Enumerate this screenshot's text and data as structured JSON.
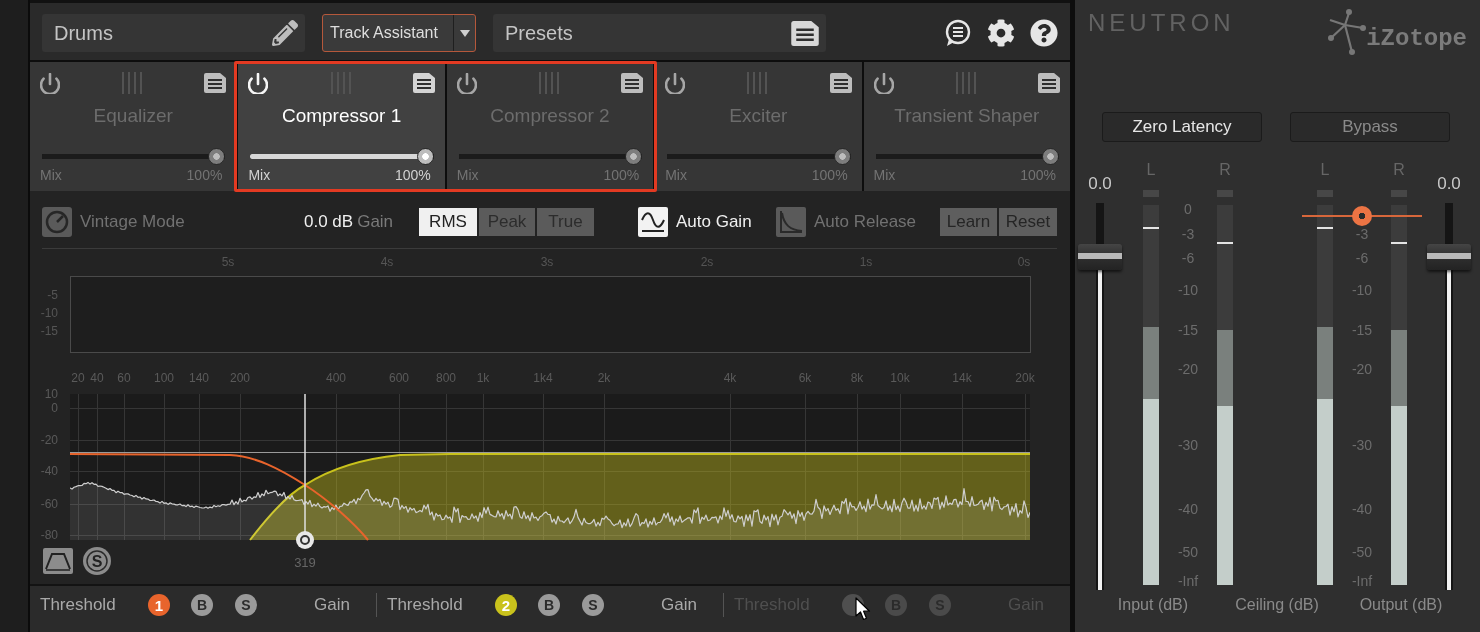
{
  "header": {
    "track_name": "Drums",
    "assistant_button": "Track Assistant",
    "presets": "Presets"
  },
  "modules": [
    {
      "name": "Equalizer",
      "selected": false,
      "highlighted": false,
      "mix_label": "Mix",
      "mix_value": "100%",
      "mix": {
        "level": 1
      }
    },
    {
      "name": "Compressor 1",
      "selected": true,
      "highlighted": true,
      "mix_label": "Mix",
      "mix_value": "100%",
      "mix": {
        "level": 1
      }
    },
    {
      "name": "Compressor 2",
      "selected": false,
      "highlighted": true,
      "mix_label": "Mix",
      "mix_value": "100%",
      "mix": {
        "level": 1
      }
    },
    {
      "name": "Exciter",
      "selected": false,
      "highlighted": false,
      "mix_label": "Mix",
      "mix_value": "100%",
      "mix": {
        "level": 1
      }
    },
    {
      "name": "Transient Shaper",
      "selected": false,
      "highlighted": false,
      "mix_label": "Mix",
      "mix_value": "100%",
      "mix": {
        "level": 1
      }
    }
  ],
  "controls": {
    "vintage_mode": {
      "label": "Vintage Mode",
      "on": false
    },
    "gain": {
      "value": "0.0 dB",
      "label": "Gain"
    },
    "detection_modes": [
      {
        "label": "RMS",
        "selected": true
      },
      {
        "label": "Peak",
        "selected": false
      },
      {
        "label": "True",
        "selected": false
      }
    ],
    "auto_gain": {
      "label": "Auto Gain",
      "on": true
    },
    "auto_release": {
      "label": "Auto Release",
      "on": false
    },
    "buttons": [
      "Learn",
      "Reset"
    ]
  },
  "gain_reduction": {
    "time_labels": [
      "5s",
      "4s",
      "3s",
      "2s",
      "1s",
      "0s"
    ],
    "db_labels": [
      "-5",
      "-10",
      "-15"
    ]
  },
  "spectrum": {
    "freq_labels": [
      "20",
      "40",
      "60",
      "100",
      "140",
      "200",
      "400",
      "600",
      "800",
      "1k",
      "1k4",
      "2k",
      "4k",
      "6k",
      "8k",
      "10k",
      "14k",
      "20k"
    ],
    "db_labels": [
      "10",
      "0",
      "-20",
      "-40",
      "-60",
      "-80"
    ],
    "crossover": "319",
    "solo_button": "S"
  },
  "bands": [
    {
      "threshold_label": "Threshold",
      "number": "1",
      "color": "#e8642c",
      "enabled": true,
      "bypass": "B",
      "solo": "S",
      "gain_label": "Gain"
    },
    {
      "threshold_label": "Threshold",
      "number": "2",
      "color": "#c9c21c",
      "enabled": true,
      "bypass": "B",
      "solo": "S",
      "gain_label": "Gain"
    },
    {
      "threshold_label": "Threshold",
      "color": "#4f4f4f",
      "enabled": false,
      "bypass": "B",
      "solo": "S",
      "gain_label": "Gain"
    }
  ],
  "output_panel": {
    "brand": "NEUTRON",
    "logo": "iZotope",
    "buttons": [
      {
        "label": "Zero Latency",
        "on": true
      },
      {
        "label": "Bypass",
        "on": false
      }
    ],
    "input": {
      "value": "0.0",
      "fader": {
        "level": 0.86
      },
      "meters": [
        {
          "channel": "L",
          "rms": {
            "level": 0.49
          },
          "peak": {
            "level": 0.68
          },
          "hold": {
            "level": 0.94
          }
        },
        {
          "channel": "R",
          "rms": {
            "level": 0.47
          },
          "peak": {
            "level": 0.67
          },
          "hold": {
            "level": 0.9
          }
        }
      ],
      "scale": [
        "0",
        "-3",
        "-6",
        "-10",
        "-15",
        "-20",
        "-30",
        "-40",
        "-50",
        "-Inf"
      ]
    },
    "output": {
      "value": "0.0",
      "fader": {
        "level": 0.86
      },
      "meters": [
        {
          "channel": "L",
          "rms": {
            "level": 0.49
          },
          "peak": {
            "level": 0.68
          },
          "hold": {
            "level": 0.94
          }
        },
        {
          "channel": "R",
          "rms": {
            "level": 0.47
          },
          "peak": {
            "level": 0.67
          },
          "hold": {
            "level": 0.9
          }
        }
      ],
      "scale": [
        "-3",
        "-6",
        "-10",
        "-15",
        "-20",
        "-30",
        "-40",
        "-50",
        "-Inf"
      ],
      "ceiling": {
        "level": 0.97
      }
    },
    "labels": [
      "Input (dB)",
      "Ceiling (dB)",
      "Output (dB)"
    ]
  }
}
